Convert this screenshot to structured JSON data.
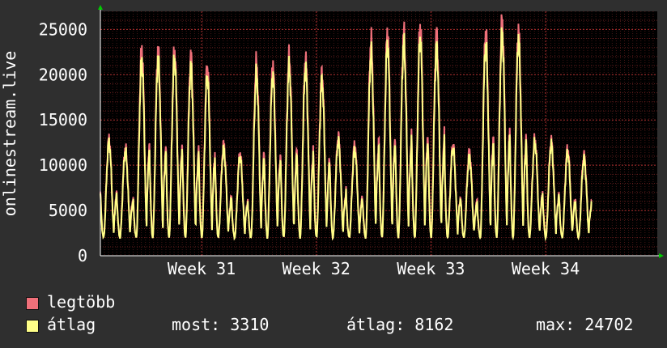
{
  "chart_data": {
    "type": "area",
    "ylabel": "onlinestream.live",
    "ylim": [
      0,
      27000
    ],
    "yticks": [
      0,
      5000,
      10000,
      15000,
      20000,
      25000
    ],
    "ytick_labels": [
      "0",
      "5000",
      "10000",
      "15000",
      "20000",
      "25000"
    ],
    "xlim": [
      0,
      34
    ],
    "xticks": [
      {
        "day": 6.18,
        "label": "Week 31"
      },
      {
        "day": 13.18,
        "label": "Week 32"
      },
      {
        "day": 20.18,
        "label": "Week 33"
      },
      {
        "day": 27.18,
        "label": "Week 34"
      }
    ],
    "grid": true,
    "daily_peaks": {
      "legtobb": [
        12900,
        11900,
        22800,
        22700,
        22700,
        22000,
        21000,
        12300,
        11300,
        21300,
        21000,
        22000,
        21800,
        20200,
        13200,
        12300,
        23800,
        24600,
        24600,
        25400,
        24500,
        12300,
        11500,
        24800,
        25900,
        24900,
        12900,
        12700,
        11900,
        11100
      ],
      "atlag": [
        12500,
        11500,
        21500,
        21700,
        21800,
        20800,
        19900,
        11800,
        10900,
        20000,
        19800,
        20800,
        20700,
        19300,
        12700,
        11700,
        22300,
        23300,
        23400,
        24000,
        23000,
        11900,
        10900,
        23400,
        24500,
        23800,
        12500,
        12300,
        11400,
        10700
      ]
    },
    "daily_min": 2000,
    "series": [
      {
        "name": "legtöbb",
        "color": "#f0707a"
      },
      {
        "name": "átlag",
        "color": "#ffff88"
      }
    ],
    "colors": {
      "background": "#2f2f2f",
      "plot": "#000000",
      "grid": "#8a2a2a",
      "axis": "#ffffff",
      "arrow": "#00cc00"
    }
  },
  "legend": {
    "max_label": "legtöbb",
    "avg_label": "átlag",
    "stat_now": "most: 3310",
    "stat_avg": "átlag: 8162",
    "stat_max": "max: 24702"
  }
}
